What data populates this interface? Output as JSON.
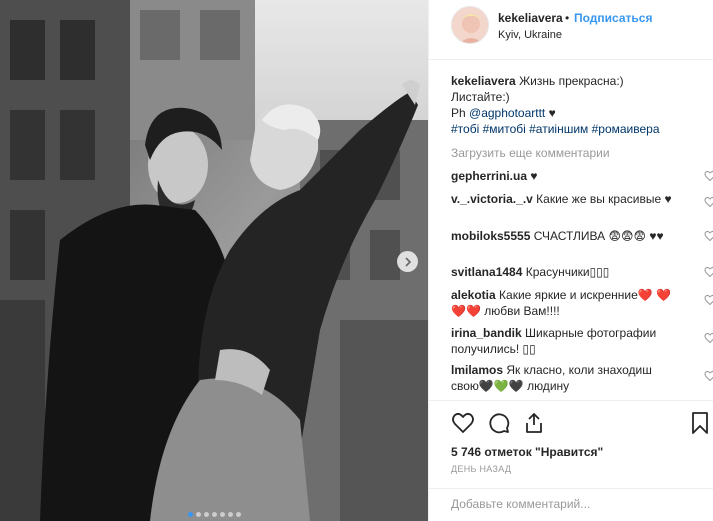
{
  "post": {
    "username": "kekeliavera",
    "separator": "•",
    "follow_label": "Подписаться",
    "location": "Kyiv, Ukraine",
    "photo_description": "black and white photo of a couple",
    "carousel_count": 7,
    "carousel_active": 0
  },
  "caption": {
    "username": "kekeliavera",
    "line1": "Жизнь прекрасна:)",
    "line2": "Листайте:)",
    "line3_prefix": "Ph",
    "mention": "@agphotoarttt",
    "line3_suffix": " ♥",
    "hashtags": "#тобі #митобі #атиіншим #ромаивера"
  },
  "load_more_label": "Загрузить еще комментарии",
  "comments": [
    {
      "username": "gepherrini.ua",
      "text": " ♥"
    },
    {
      "username": "v._.victoria._.v",
      "text": " Какие же вы красивые ♥"
    },
    {
      "username": "mobiloks5555",
      "text": " СЧАСТЛИВА 😨😨😨 ♥♥"
    },
    {
      "username": "svitlana1484",
      "text": " Красунчики▯▯▯"
    },
    {
      "username": "alekotia",
      "text": " Какие яркие и искренние❤️ ❤️❤️❤️ любви Вам!!!!"
    },
    {
      "username": "irina_bandik",
      "text": " Шикарные фотографии получились! ▯▯"
    },
    {
      "username": "lmilamos",
      "text": " Як класно, коли знаходиш свою🖤💚🖤 людину"
    }
  ],
  "likes_label": "5 746 отметок \"Нравится\"",
  "time_label": "ДЕНЬ НАЗАД",
  "add_comment_placeholder": "Добавьте комментарий...",
  "icons": {
    "like": "heart-icon",
    "comment": "comment-icon",
    "share": "share-icon",
    "save": "bookmark-icon",
    "next": "chevron-right-icon"
  },
  "colors": {
    "link_blue": "#3897f0",
    "hashtag": "#003569",
    "muted": "#999999",
    "text": "#262626"
  }
}
